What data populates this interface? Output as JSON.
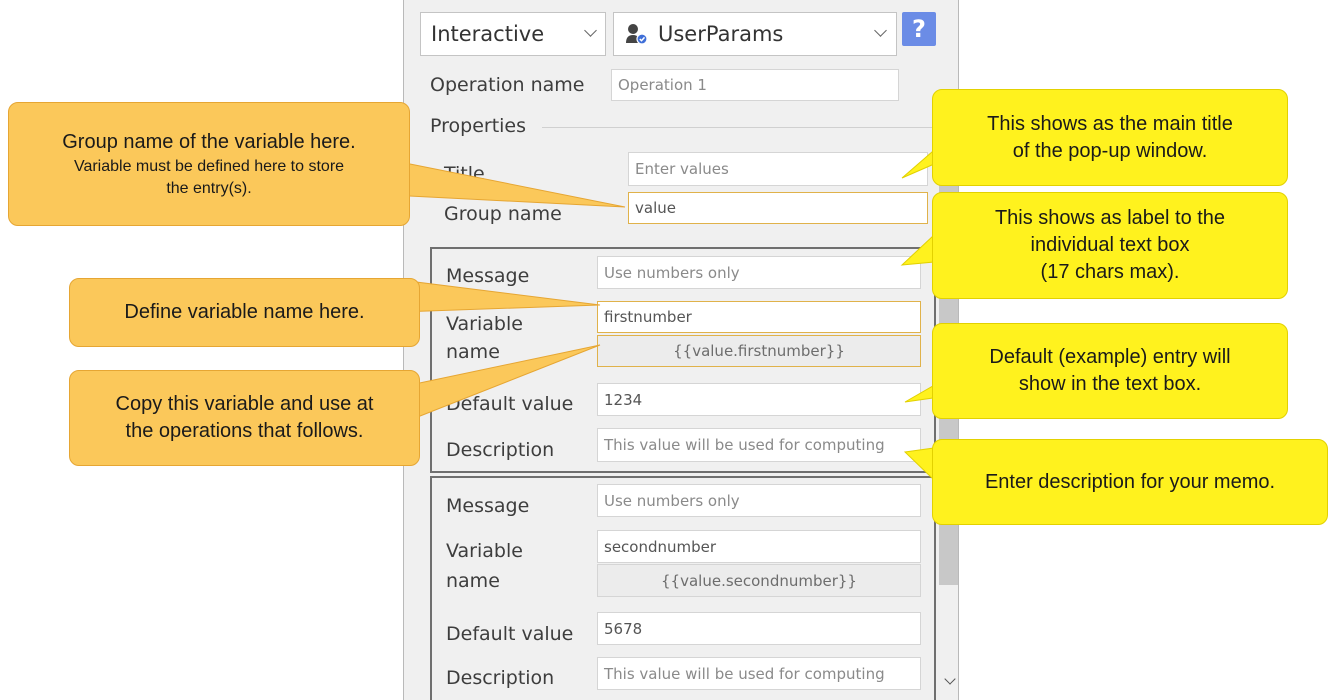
{
  "header": {
    "mode_select": "Interactive",
    "operation_select": "UserParams",
    "help_label": "?"
  },
  "operation": {
    "label": "Operation name",
    "value": "Operation 1"
  },
  "properties": {
    "legend": "Properties",
    "title_label": "Title",
    "title_value": "Enter values",
    "group_label": "Group name",
    "group_value": "value"
  },
  "entries": [
    {
      "message_label": "Message",
      "message_value": "Use numbers only",
      "variable_label_1": "Variable",
      "variable_label_2": "name",
      "variable_value": "firstnumber",
      "variable_ref": "{{value.firstnumber}}",
      "default_label": "Default value",
      "default_value": "1234",
      "description_label": "Description",
      "description_value": "This value will be used for computing"
    },
    {
      "message_label": "Message",
      "message_value": "Use numbers only",
      "variable_label_1": "Variable",
      "variable_label_2": "name",
      "variable_value": "secondnumber",
      "variable_ref": "{{value.secondnumber}}",
      "default_label": "Default value",
      "default_value": "5678",
      "description_label": "Description",
      "description_value": "This value will be used for computing"
    }
  ],
  "callouts": {
    "group": {
      "line1": "Group name of the variable here.",
      "line2": "Variable must be defined here to store",
      "line3": "the entry(s)."
    },
    "define": {
      "line1": "Define variable name here."
    },
    "copy": {
      "line1": "Copy this variable and use at",
      "line2": "the operations that follows."
    },
    "title": {
      "line1": "This shows as the main title",
      "line2": "of the pop-up window."
    },
    "label": {
      "line1": "This shows as label to the",
      "line2": "individual text box",
      "line3": "(17 chars max)."
    },
    "default": {
      "line1": "Default (example) entry will",
      "line2": "show in the text box."
    },
    "description": {
      "line1": "Enter description for your memo."
    }
  },
  "colors": {
    "orange_callout": "#fbc85a",
    "yellow_callout": "#fff21e",
    "help_button": "#6b8ce6",
    "highlight_border": "#e0b24a"
  }
}
